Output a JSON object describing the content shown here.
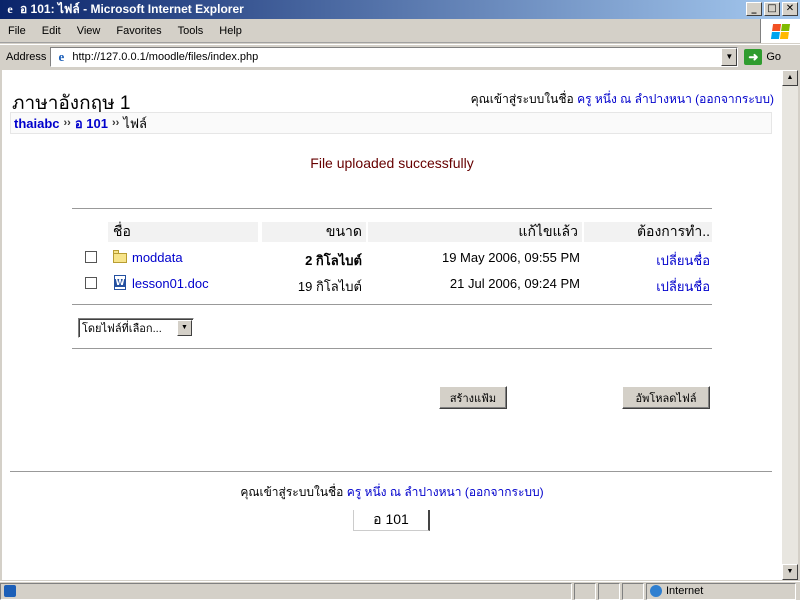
{
  "window": {
    "title": "อ 101: ไฟล์ - Microsoft Internet Explorer",
    "minimize": "_",
    "maximize": "□",
    "close": "✕"
  },
  "menubar": {
    "items": [
      "File",
      "Edit",
      "View",
      "Favorites",
      "Tools",
      "Help"
    ]
  },
  "address": {
    "label": "Address",
    "url": "http://127.0.0.1/moodle/files/index.php",
    "go_label": "Go"
  },
  "page": {
    "course_title": "ภาษาอังกฤษ 1",
    "login": {
      "prefix": "คุณเข้าสู่ระบบในชื่อ",
      "user": "ครู หนึ่ง ณ ลำปางหนา",
      "logout": "(ออกจากระบบ)"
    },
    "breadcrumb": {
      "site": "thaiabc",
      "separator": "››",
      "course": "อ 101",
      "current": "ไฟล์"
    },
    "notice": "File uploaded successfully",
    "table": {
      "headers": {
        "name": "ชื่อ",
        "size": "ขนาด",
        "modified": "แก้ไขแล้ว",
        "actions": "ต้องการทำ.."
      },
      "rows": [
        {
          "name": "moddata",
          "size": "2 กิโลไบต์",
          "modified": "19 May 2006, 09:55 PM",
          "action": "เปลี่ยนชื่อ",
          "icon": "folder-icon"
        },
        {
          "name": "lesson01.doc",
          "size": "19 กิโลไบต์",
          "modified": "21 Jul 2006, 09:24 PM",
          "action": "เปลี่ยนชื่อ",
          "icon": "word-doc-icon"
        }
      ]
    },
    "with_selected": "โดยไฟล์ที่เลือก...",
    "make_folder": "สร้างแฟ้ม",
    "upload_file": "อัพโหลดไฟล์",
    "footer": {
      "prefix": "คุณเข้าสู่ระบบในชื่อ",
      "user": "ครู หนึ่ง ณ ลำปางหนา",
      "logout": "(ออกจากระบบ)",
      "course_short": "อ 101"
    }
  },
  "status": {
    "zone": "Internet"
  },
  "colors": {
    "link": "#0000cc",
    "notice": "#660000",
    "titlebar_start": "#0a246a",
    "titlebar_end": "#a6caf0"
  }
}
